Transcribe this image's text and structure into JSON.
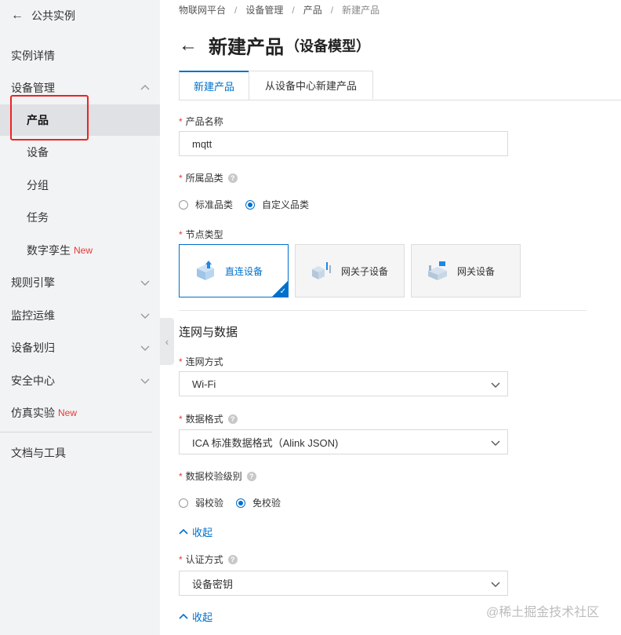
{
  "sidebar": {
    "back_label": "公共实例",
    "items": [
      {
        "label": "实例详情"
      },
      {
        "label": "设备管理"
      },
      {
        "label": "产品"
      },
      {
        "label": "设备"
      },
      {
        "label": "分组"
      },
      {
        "label": "任务"
      },
      {
        "label": "数字孪生",
        "tag": "New"
      },
      {
        "label": "规则引擎"
      },
      {
        "label": "监控运维"
      },
      {
        "label": "设备划归"
      },
      {
        "label": "安全中心"
      },
      {
        "label": "仿真实验",
        "tag": "New"
      },
      {
        "label": "文档与工具"
      }
    ]
  },
  "breadcrumb": [
    "物联网平台",
    "设备管理",
    "产品",
    "新建产品"
  ],
  "breadcrumb_sep": "/",
  "title": {
    "main": "新建产品",
    "suffix": "（设备模型）"
  },
  "tabs": [
    {
      "label": "新建产品",
      "active": true
    },
    {
      "label": "从设备中心新建产品",
      "active": false
    }
  ],
  "form": {
    "required_mark": "*",
    "help_mark": "?",
    "product_name": {
      "label": "产品名称",
      "value": "mqtt"
    },
    "category": {
      "label": "所属品类",
      "options": [
        "标准品类",
        "自定义品类"
      ],
      "selected": "自定义品类"
    },
    "node_type": {
      "label": "节点类型",
      "options": [
        "直连设备",
        "网关子设备",
        "网关设备"
      ],
      "selected": "直连设备"
    },
    "section_title": "连网与数据",
    "network": {
      "label": "连网方式",
      "value": "Wi-Fi"
    },
    "data_format": {
      "label": "数据格式",
      "value": "ICA 标准数据格式（Alink JSON)"
    },
    "check_level": {
      "label": "数据校验级别",
      "options": [
        "弱校验",
        "免校验"
      ],
      "selected": "免校验"
    },
    "collapse_label": "收起",
    "auth": {
      "label": "认证方式",
      "value": "设备密钥"
    }
  },
  "watermark": "@稀土掘金技术社区",
  "colors": {
    "accent": "#0070cc",
    "danger": "#e53935",
    "sidebar_bg": "#f2f3f5"
  }
}
